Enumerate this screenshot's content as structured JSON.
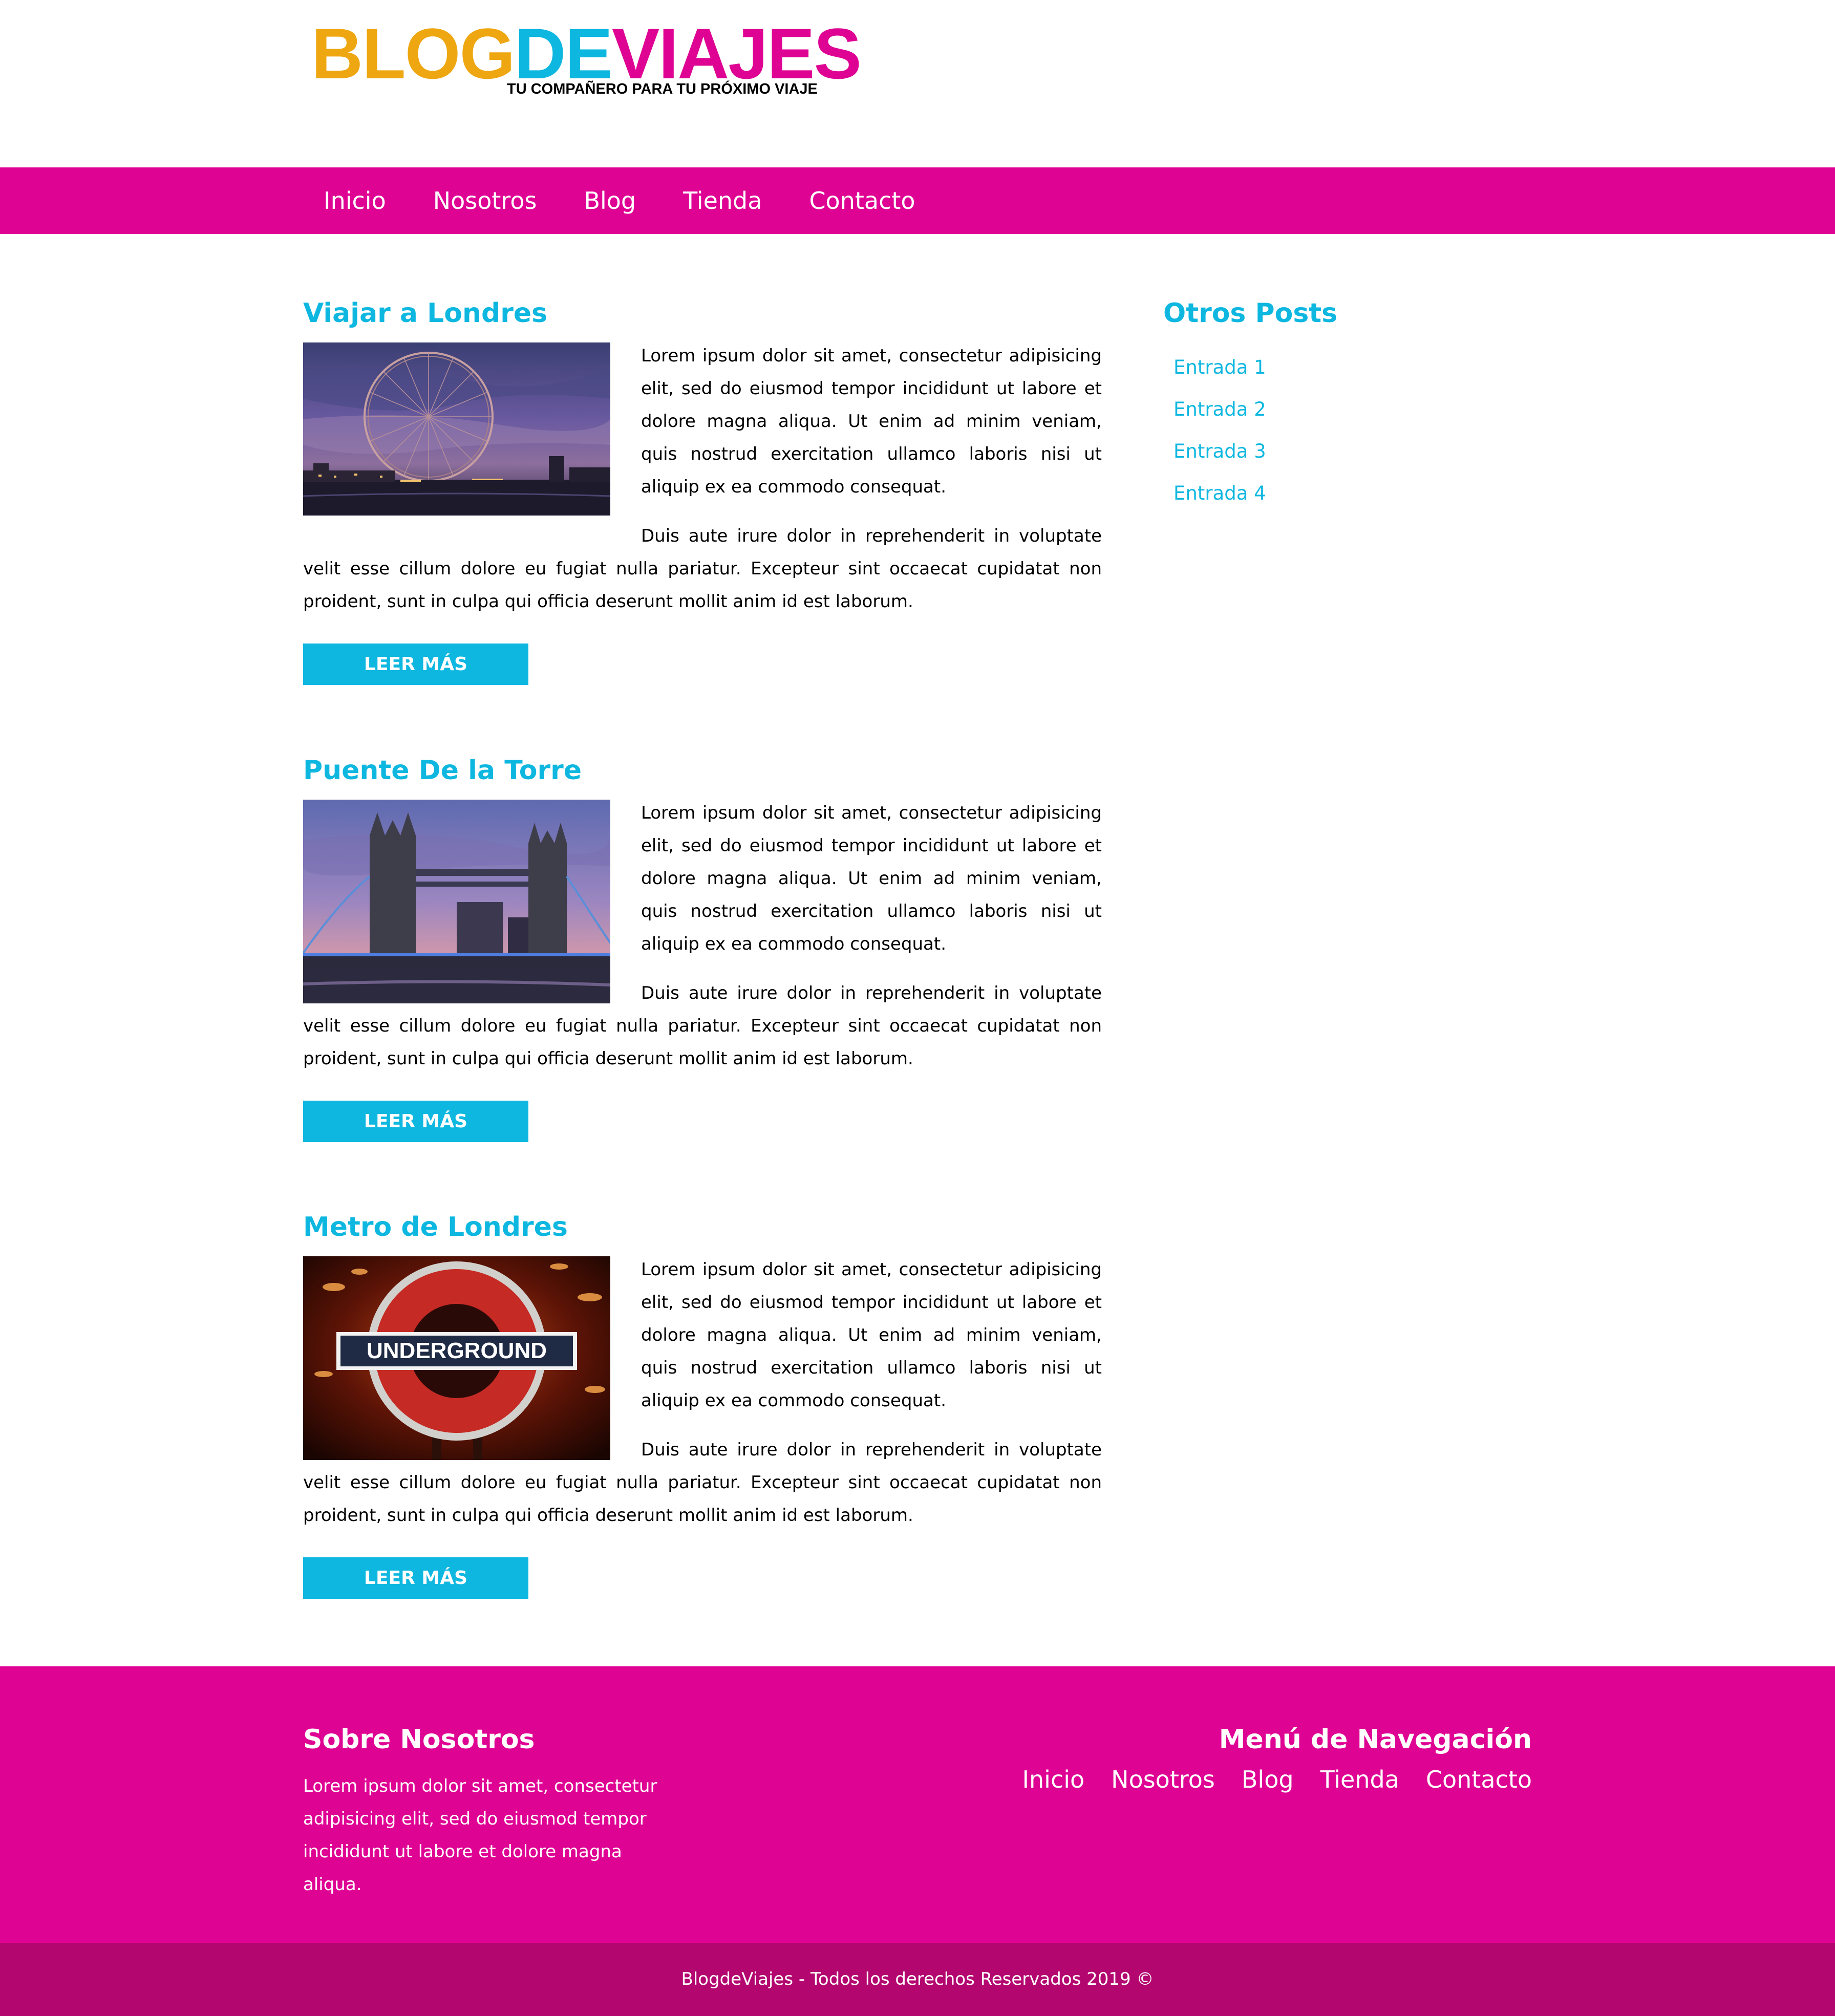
{
  "brand": {
    "logo_part1": "BLOG",
    "logo_part2": "DE",
    "logo_part3": "VIAJES",
    "tagline": "TU COMPAÑERO PARA TU PRÓXIMO VIAJE",
    "colors": {
      "orange": "#eea711",
      "blue": "#0db7e0",
      "magenta": "#df0394",
      "dark_magenta": "#b3066f"
    }
  },
  "nav": {
    "items": [
      "Inicio",
      "Nosotros",
      "Blog",
      "Tienda",
      "Contacto"
    ]
  },
  "posts": [
    {
      "title": "Viajar a Londres",
      "image": "london-eye-photo",
      "para1": "Lorem ipsum dolor sit amet, consectetur adipisicing elit, sed do eiusmod tempor incididunt ut labore et dolore magna aliqua. Ut enim ad minim veniam, quis nostrud exercitation ullamco laboris nisi ut aliquip ex ea commodo consequat.",
      "para2": "Duis aute irure dolor in reprehenderit in voluptate velit esse cillum dolore eu fugiat nulla pariatur. Excepteur sint occaecat cupidatat non proident, sunt in culpa qui officia deserunt mollit anim id est laborum.",
      "button": "LEER MÁS"
    },
    {
      "title": "Puente De la Torre",
      "image": "tower-bridge-photo",
      "para1": "Lorem ipsum dolor sit amet, consectetur adipisicing elit, sed do eiusmod tempor incididunt ut labore et dolore magna aliqua. Ut enim ad minim veniam, quis nostrud exercitation ullamco laboris nisi ut aliquip ex ea commodo consequat.",
      "para2": "Duis aute irure dolor in reprehenderit in voluptate velit esse cillum dolore eu fugiat nulla pariatur. Excepteur sint occaecat cupidatat non proident, sunt in culpa qui officia deserunt mollit anim id est laborum.",
      "button": "LEER MÁS"
    },
    {
      "title": "Metro de Londres",
      "image": "underground-sign-photo",
      "image_text": "UNDERGROUND",
      "para1": "Lorem ipsum dolor sit amet, consectetur adipisicing elit, sed do eiusmod tempor incididunt ut labore et dolore magna aliqua. Ut enim ad minim veniam, quis nostrud exercitation ullamco laboris nisi ut aliquip ex ea commodo consequat.",
      "para2": "Duis aute irure dolor in reprehenderit in voluptate velit esse cillum dolore eu fugiat nulla pariatur. Excepteur sint occaecat cupidatat non proident, sunt in culpa qui officia deserunt mollit anim id est laborum.",
      "button": "LEER MÁS"
    }
  ],
  "sidebar": {
    "title": "Otros Posts",
    "items": [
      "Entrada 1",
      "Entrada 2",
      "Entrada 3",
      "Entrada 4"
    ]
  },
  "footer": {
    "about_title": "Sobre Nosotros",
    "about_text": "Lorem ipsum dolor sit amet, consectetur adipisicing elit, sed do eiusmod tempor incididunt ut labore et dolore magna aliqua.",
    "nav_title": "Menú de Navegación",
    "nav_items": [
      "Inicio",
      "Nosotros",
      "Blog",
      "Tienda",
      "Contacto"
    ],
    "copyright": "BlogdeViajes - Todos los derechos Reservados 2019 ©"
  }
}
